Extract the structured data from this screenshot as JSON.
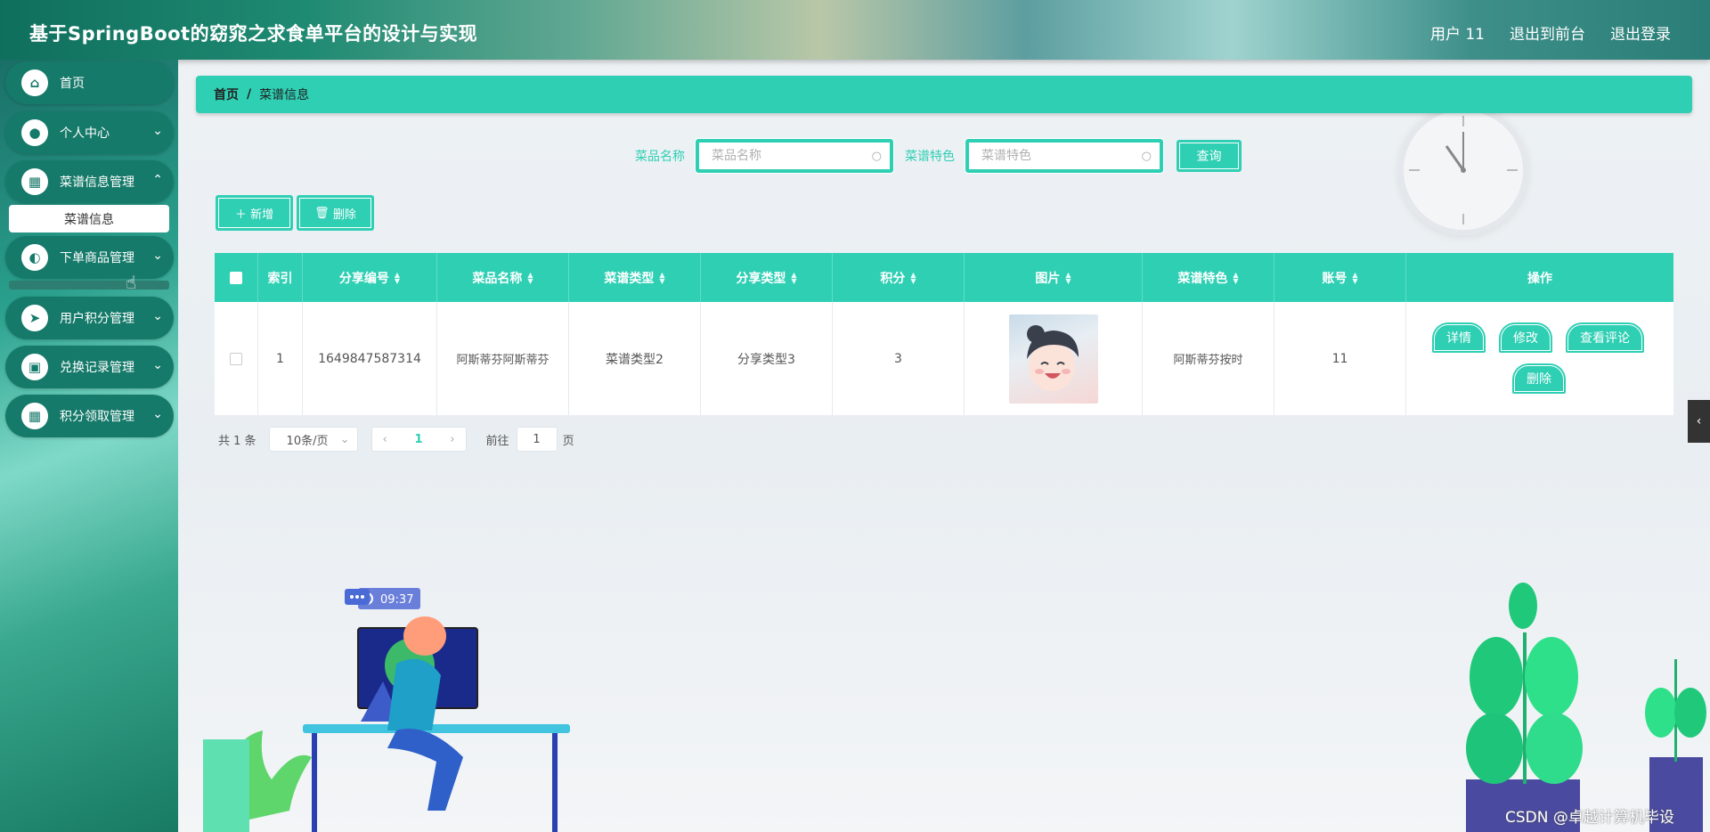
{
  "header": {
    "title": "基于SpringBoot的窈窕之求食单平台的设计与实现",
    "user": "用户 11",
    "to_front": "退出到前台",
    "logout": "退出登录"
  },
  "sidebar": {
    "items": [
      {
        "label": "首页",
        "icon": "home-icon"
      },
      {
        "label": "个人中心",
        "icon": "user-icon"
      },
      {
        "label": "菜谱信息管理",
        "icon": "grid-icon"
      },
      {
        "label": "下单商品管理",
        "icon": "bulb-icon"
      },
      {
        "label": "用户积分管理",
        "icon": "send-icon"
      },
      {
        "label": "兑换记录管理",
        "icon": "briefcase-icon"
      },
      {
        "label": "积分领取管理",
        "icon": "grid-icon"
      }
    ],
    "sub_item": "菜谱信息"
  },
  "breadcrumb": {
    "home": "首页",
    "sep": "/",
    "current": "菜谱信息"
  },
  "search": {
    "name_label": "菜品名称",
    "name_placeholder": "菜品名称",
    "feature_label": "菜谱特色",
    "feature_placeholder": "菜谱特色",
    "query_label": "查询"
  },
  "actions": {
    "add": "新增",
    "delete": "删除"
  },
  "table": {
    "headers": [
      "索引",
      "分享编号",
      "菜品名称",
      "菜谱类型",
      "分享类型",
      "积分",
      "图片",
      "菜谱特色",
      "账号",
      "操作"
    ],
    "rows": [
      {
        "index": "1",
        "share_no": "1649847587314",
        "dish_name": "阿斯蒂芬阿斯蒂芬",
        "recipe_type": "菜谱类型2",
        "share_type": "分享类型3",
        "points": "3",
        "feature": "阿斯蒂芬按时",
        "account": "11",
        "ops": [
          "详情",
          "修改",
          "查看评论",
          "删除"
        ]
      }
    ]
  },
  "pagination": {
    "total": "共 1 条",
    "page_size": "10条/页",
    "current": "1",
    "goto_prefix": "前往",
    "goto_value": "1",
    "goto_suffix": "页"
  },
  "decor": {
    "clock_time": "09:37"
  },
  "watermark": "CSDN @卓越计算机毕设",
  "colors": {
    "accent": "#2fcfb4",
    "nav": "#167a6a"
  }
}
